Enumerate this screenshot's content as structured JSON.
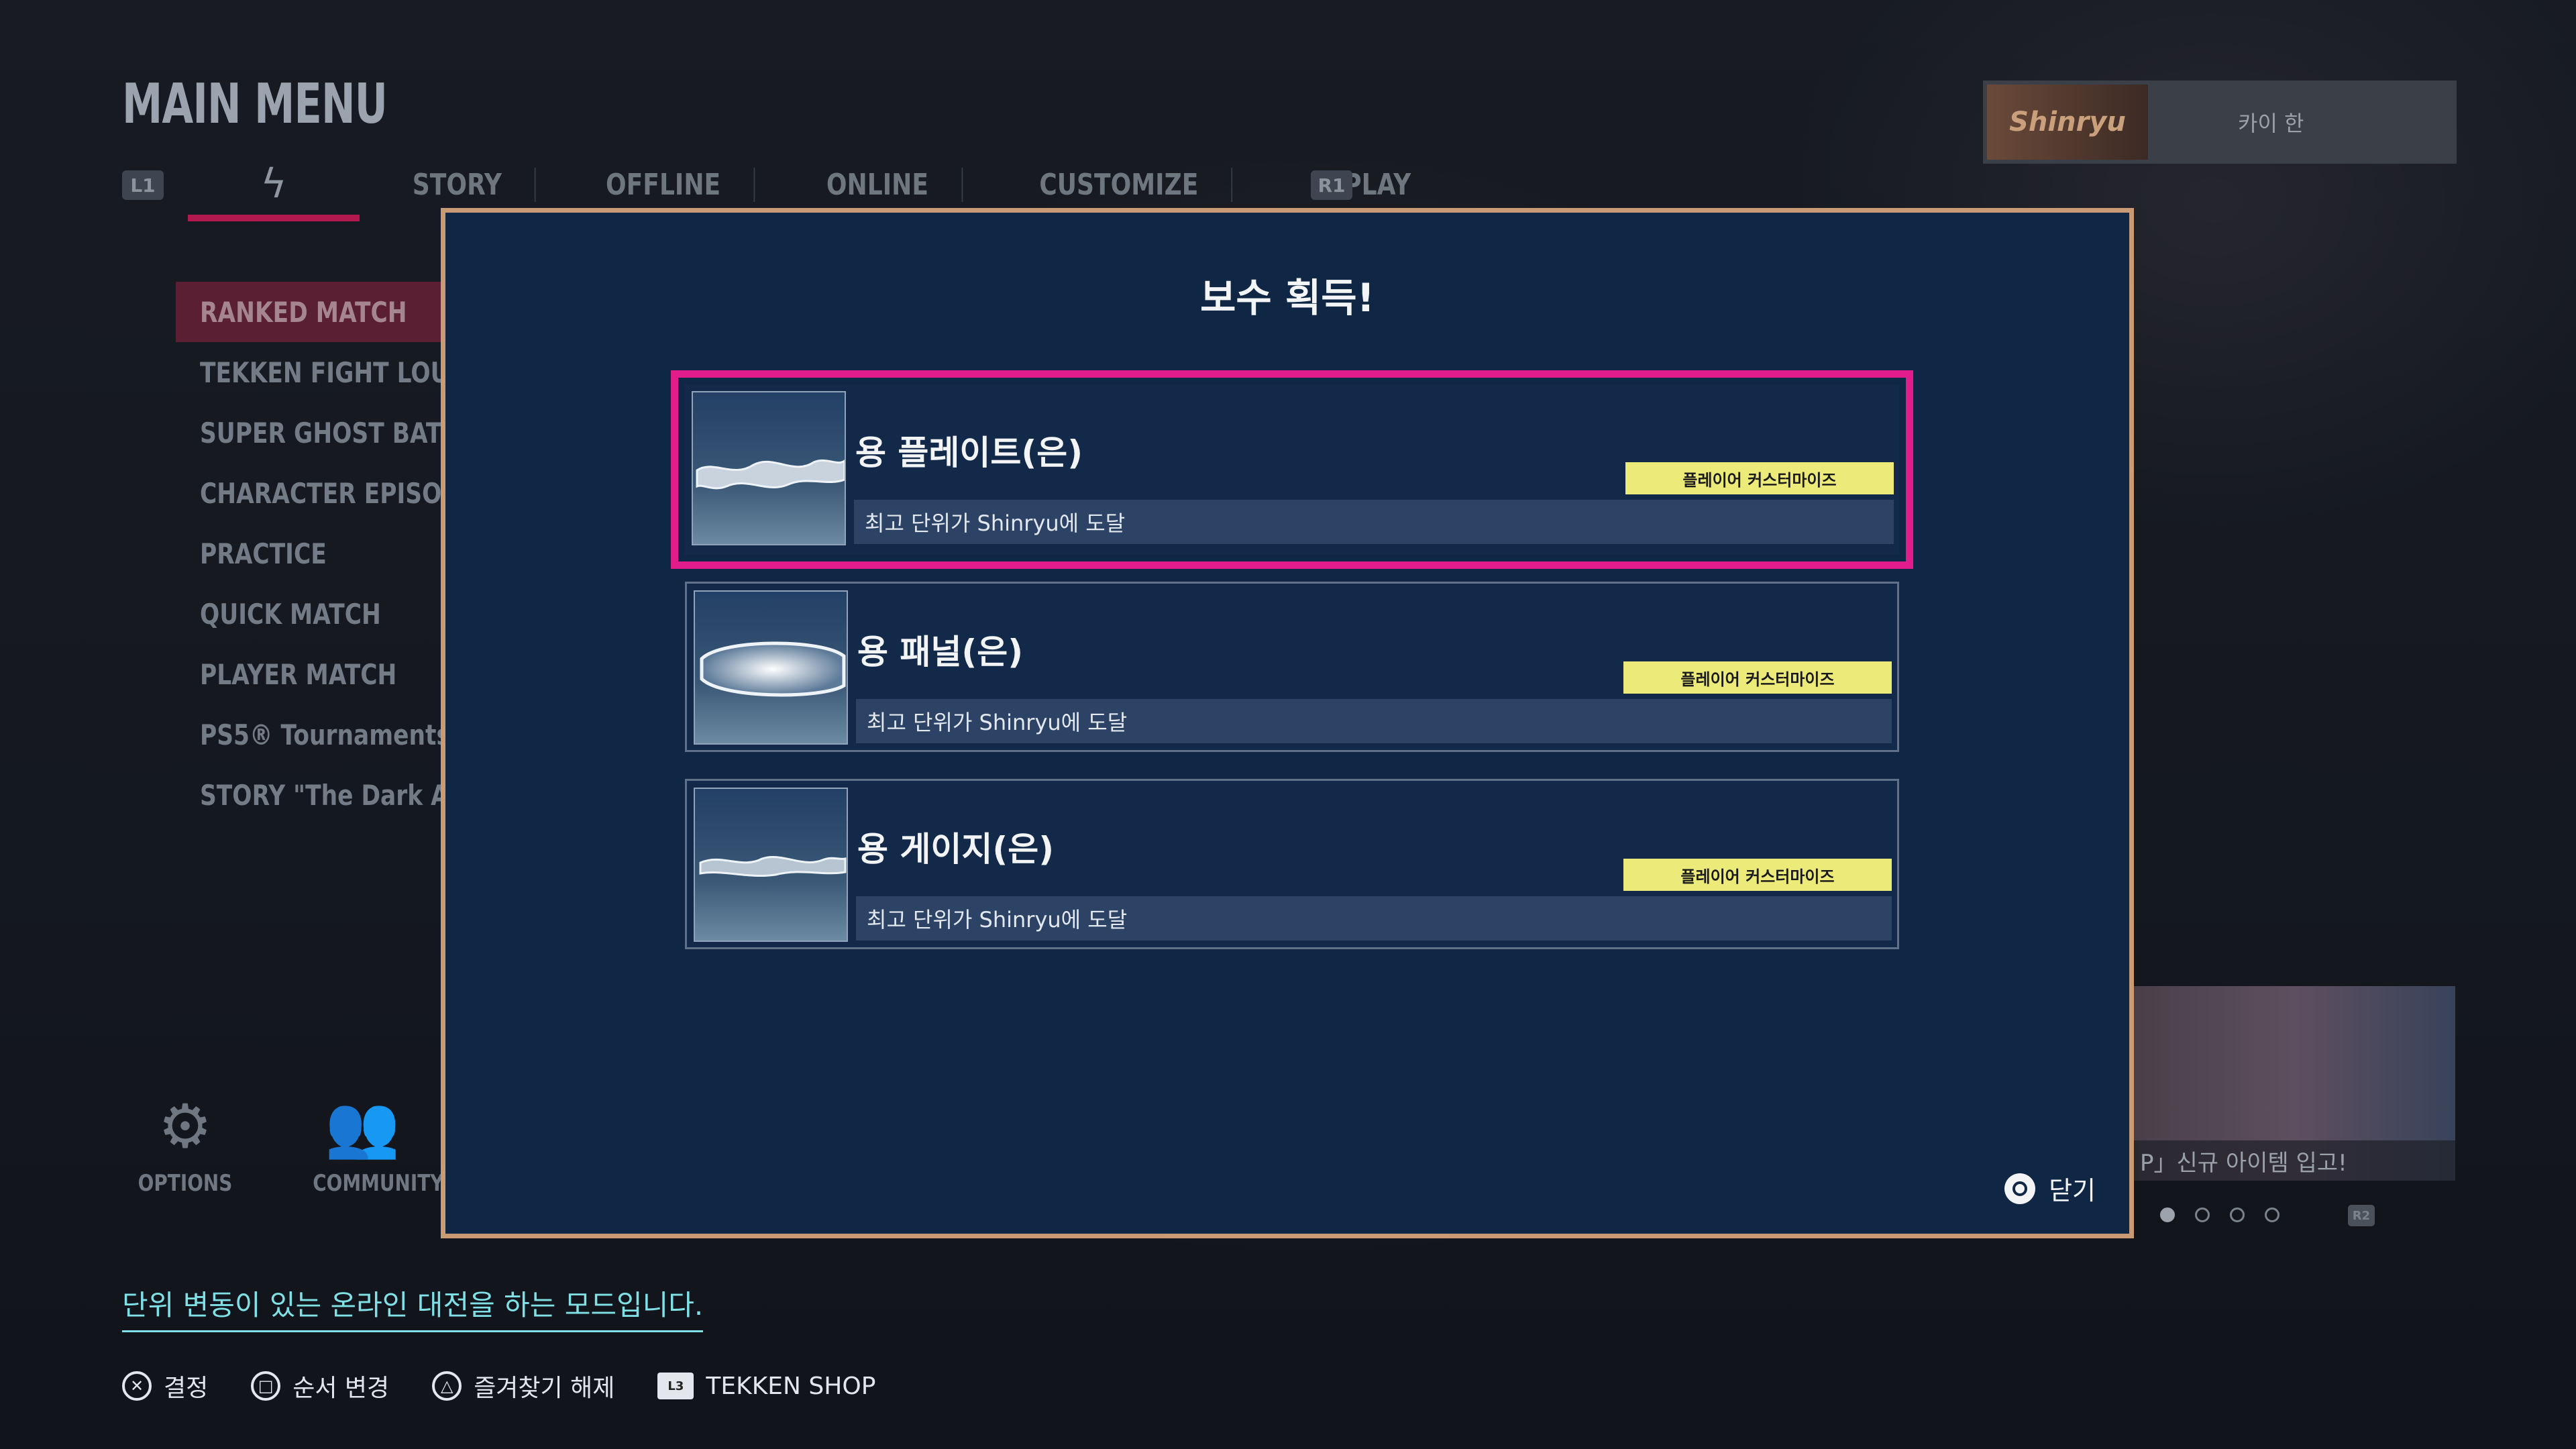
{
  "header": {
    "title": "MAIN MENU",
    "shoulder_left": "L1",
    "shoulder_right": "R1",
    "tabs": [
      "STORY",
      "OFFLINE",
      "ONLINE",
      "CUSTOMIZE",
      "REPLAY"
    ]
  },
  "profile": {
    "plate_text": "Shinryu",
    "name": "카이 한"
  },
  "menu": {
    "items": [
      "RANKED MATCH",
      "TEKKEN FIGHT LOUNGE",
      "SUPER GHOST BATTLE",
      "CHARACTER EPISODES",
      "PRACTICE",
      "QUICK MATCH",
      "PLAYER MATCH",
      "PS5® Tournaments",
      "STORY \"The Dark Awa"
    ]
  },
  "bottom_icons": {
    "options": "OPTIONS",
    "community": "COMMUNITY"
  },
  "promo": {
    "text": "P」신규 아이템 입고!",
    "r2": "R2"
  },
  "description": "단위 변동이 있는 온라인 대전을 하는 모드입니다.",
  "guide": {
    "confirm": "결정",
    "reorder": "순서 변경",
    "unfavorite": "즐겨찾기 해제",
    "shop": "TEKKEN SHOP",
    "shop_button": "L3"
  },
  "modal": {
    "title": "보수 획득!",
    "rewards": [
      {
        "name": "용 플레이트(은)",
        "tag": "플레이어 커스터마이즈",
        "condition": "최고 단위가 Shinryu에 도달"
      },
      {
        "name": "용 패널(은)",
        "tag": "플레이어 커스터마이즈",
        "condition": "최고 단위가 Shinryu에 도달"
      },
      {
        "name": "용 게이지(은)",
        "tag": "플레이어 커스터마이즈",
        "condition": "최고 단위가 Shinryu에 도달"
      }
    ],
    "close_label": "닫기"
  },
  "colors": {
    "highlight": "#e31c8c",
    "tag_bg": "#ecea78",
    "modal_bg": "#0f2745",
    "modal_border": "#c99b74",
    "accent_desc": "#7fe0e6"
  }
}
